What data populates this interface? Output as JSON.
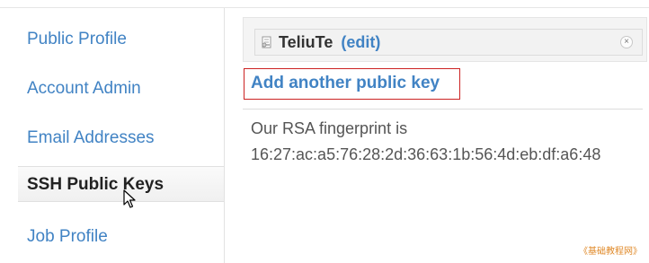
{
  "sidebar": {
    "items": [
      {
        "label": "Public Profile"
      },
      {
        "label": "Account Admin"
      },
      {
        "label": "Email Addresses"
      },
      {
        "label": "SSH Public Keys"
      },
      {
        "label": "Job Profile"
      }
    ]
  },
  "key": {
    "name": "TeliuTe",
    "edit_label": "(edit)",
    "close_glyph": "×"
  },
  "add_key_label": "Add another public key",
  "fingerprint": {
    "label": "Our RSA fingerprint is",
    "value": "16:27:ac:a5:76:28:2d:36:63:1b:56:4d:eb:df:a6:48"
  },
  "watermark": "《基础教程网》",
  "colors": {
    "link": "#4183c4",
    "highlight_border": "#cc2222",
    "watermark": "#e08a2a"
  },
  "icons": {
    "key_icon": "key-icon",
    "close_icon": "close-icon",
    "cursor": "mouse-pointer-icon"
  }
}
